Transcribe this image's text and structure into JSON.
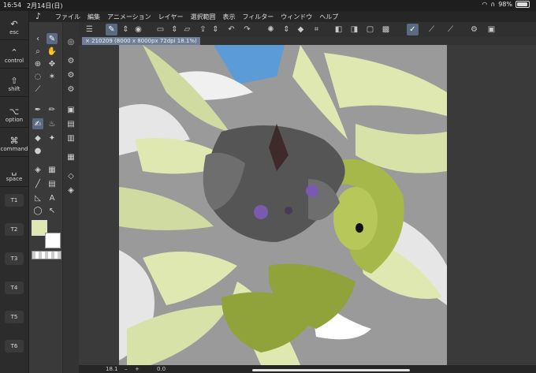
{
  "status": {
    "time": "16:54",
    "date": "2月14日(日)",
    "battery": "98%"
  },
  "menu": [
    "ファイル",
    "編集",
    "アニメーション",
    "レイヤー",
    "選択範囲",
    "表示",
    "フィルター",
    "ウィンドウ",
    "ヘルプ"
  ],
  "document_tab": "210209 (8000 x 8000px 72dpi 18.1%)",
  "edge_keys": [
    {
      "glyph": "↶",
      "label": "esc"
    },
    {
      "glyph": "⌃",
      "label": "control"
    },
    {
      "glyph": "⇧",
      "label": "shift"
    },
    {
      "glyph": "⌥",
      "label": "option"
    },
    {
      "glyph": "⌘",
      "label": "command"
    },
    {
      "glyph": "␣",
      "label": "space"
    }
  ],
  "tkeys": [
    "T1",
    "T2",
    "T3",
    "T4",
    "T5",
    "T6"
  ],
  "bottom": {
    "zoom": "18.1",
    "minus": "–",
    "plus": "+",
    "rotation": "0.0"
  },
  "colors": {
    "main": "#dfe8b0",
    "sub": "#ffffff",
    "accent": "#5a6a80"
  }
}
